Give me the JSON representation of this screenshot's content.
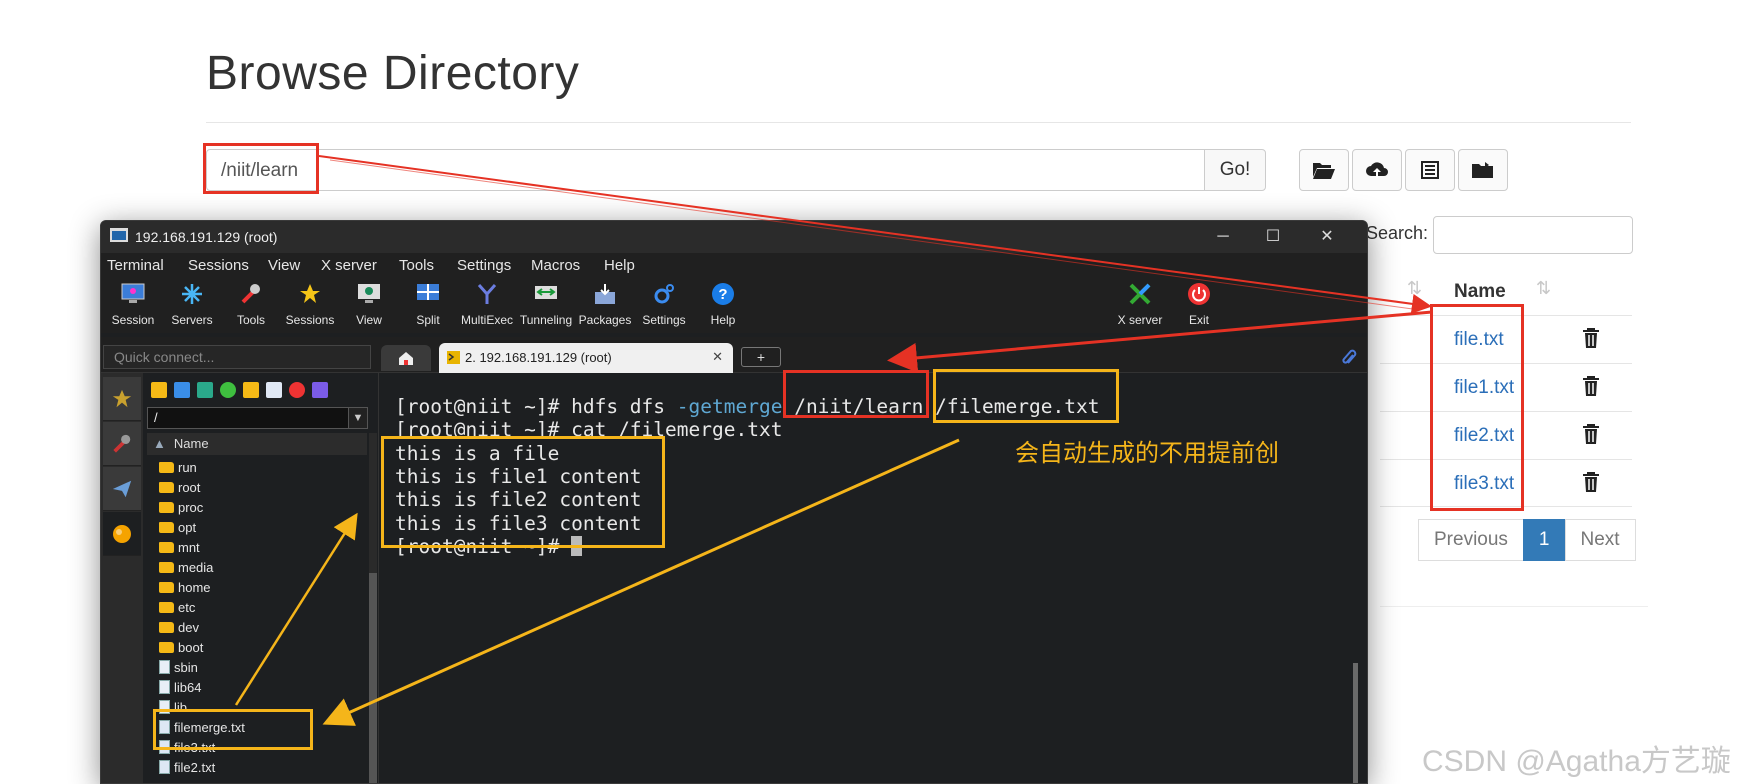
{
  "browser": {
    "page_title": "Browse Directory",
    "path_value": "/niit/learn",
    "go_label": "Go!",
    "search_label": "Search:",
    "table_header": "Name",
    "files": [
      "file.txt",
      "file1.txt",
      "file2.txt",
      "file3.txt"
    ],
    "pagination": {
      "previous": "Previous",
      "current": "1",
      "next": "Next"
    }
  },
  "terminal": {
    "window_title": "192.168.191.129 (root)",
    "menu": [
      "Terminal",
      "Sessions",
      "View",
      "X server",
      "Tools",
      "Settings",
      "Macros",
      "Help"
    ],
    "toolbar": [
      "Session",
      "Servers",
      "Tools",
      "Sessions",
      "View",
      "Split",
      "MultiExec",
      "Tunneling",
      "Packages",
      "Settings",
      "Help"
    ],
    "toolbar_right": [
      "X server",
      "Exit"
    ],
    "quick_connect_placeholder": "Quick connect...",
    "tab_label": "2. 192.168.191.129 (root)",
    "sftp_path": "/",
    "sftp_column": "Name",
    "sftp_items": [
      {
        "name": "run",
        "type": "folder"
      },
      {
        "name": "root",
        "type": "folder"
      },
      {
        "name": "proc",
        "type": "folder"
      },
      {
        "name": "opt",
        "type": "folder"
      },
      {
        "name": "mnt",
        "type": "folder"
      },
      {
        "name": "media",
        "type": "folder"
      },
      {
        "name": "home",
        "type": "folder"
      },
      {
        "name": "etc",
        "type": "folder"
      },
      {
        "name": "dev",
        "type": "folder"
      },
      {
        "name": "boot",
        "type": "folder"
      },
      {
        "name": "sbin",
        "type": "link"
      },
      {
        "name": "lib64",
        "type": "link"
      },
      {
        "name": "lib",
        "type": "link"
      },
      {
        "name": "filemerge.txt",
        "type": "file"
      },
      {
        "name": "file3.txt",
        "type": "file"
      },
      {
        "name": "file2.txt",
        "type": "file"
      }
    ],
    "lines": {
      "prompt": "[root@niit ~]# ",
      "cmd1_pre": "hdfs dfs ",
      "cmd1_kw": "-getmerge",
      "cmd1_src": "/niit/learn",
      "cmd1_dst": "/filemerge.txt",
      "cmd2": "cat /filemerge.txt",
      "out1": "this is a file",
      "out2": "this is file1 content",
      "out3": "this is file2 content",
      "out4": "this is file3 content"
    }
  },
  "annotation": {
    "note": "会自动生成的不用提前创"
  },
  "watermark": "CSDN @Agatha方艺璇",
  "colors": {
    "annotation_red": "#e53224",
    "annotation_amber": "#f5b51a",
    "link_blue": "#2a6eb8",
    "active_page": "#337ab7"
  }
}
